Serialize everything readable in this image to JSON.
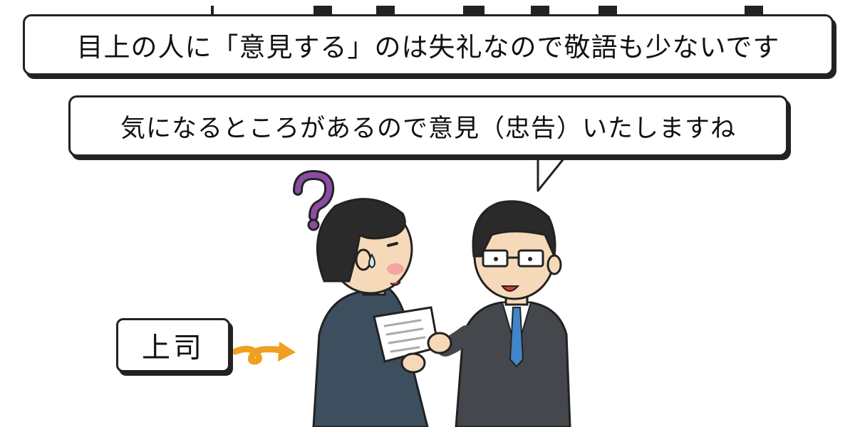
{
  "speech_top": "目上の人に「意見する」のは失礼なので敬語も少ないです",
  "speech_mid": "気になるところがあるので意見（忠告）いたしますね",
  "label_boss": "上司",
  "icons": [
    "question-mark-icon",
    "arrow-icon",
    "sweat-drop-icon"
  ],
  "colors": {
    "outline": "#222222",
    "question_mark": "#8a4ca5",
    "arrow": "#f0a020",
    "suit_boss": "#3d4f5e",
    "suit_subordinate": "#44474b",
    "skin": "#f6d9b8",
    "tie": "#3f87c8",
    "hair": "#2a2a2a"
  }
}
